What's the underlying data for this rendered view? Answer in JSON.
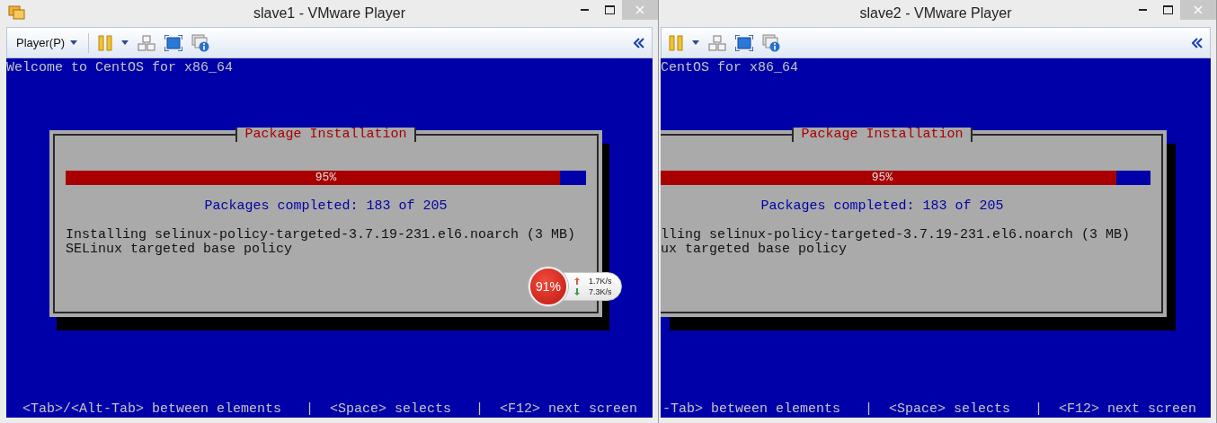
{
  "windows": [
    {
      "title": "slave1 - VMware Player",
      "menu_label": "Player(P)",
      "overlapped": false,
      "console": {
        "header": "Welcome to CentOS for x86_64",
        "dialog": {
          "title": "Package Installation",
          "progress": {
            "level": 0.95,
            "label": "95%"
          },
          "status": "Packages completed: 183 of 205",
          "lines": [
            "Installing selinux-policy-targeted-3.7.19-231.el6.noarch (3 MB)",
            "SELinux targeted base policy"
          ]
        },
        "footer": "<Tab>/<Alt-Tab> between elements   |  <Space> selects   |  <F12> next screen"
      }
    },
    {
      "title": "slave2 - VMware Player",
      "overlapped": true,
      "console": {
        "header": "CentOS for x86_64",
        "dialog": {
          "title": "Package Installation",
          "progress": {
            "level": 0.93,
            "label": "95%"
          },
          "status": "Packages completed: 183 of 205",
          "lines": [
            "lling selinux-policy-targeted-3.7.19-231.el6.noarch (3 MB)",
            "ux targeted base policy"
          ]
        },
        "footer": "-Tab> between elements   |  <Space> selects   |  <F12> next screen"
      }
    }
  ],
  "network_meter": {
    "usage": "91%",
    "upload": "1.7K/s",
    "download": "7.3K/s"
  }
}
